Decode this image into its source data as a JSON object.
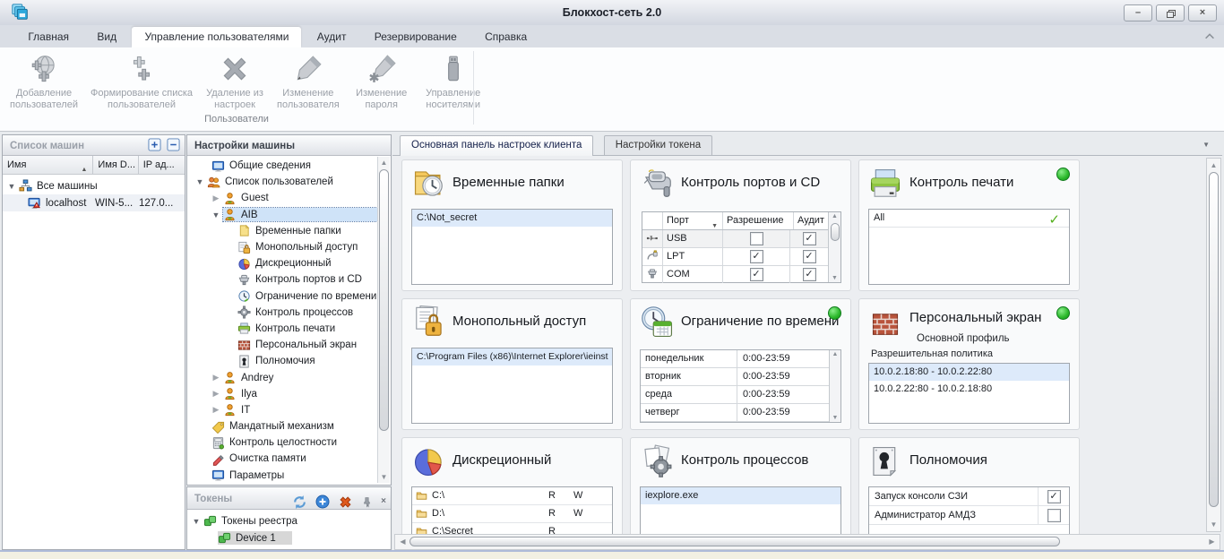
{
  "window": {
    "title": "Блокхост-сеть 2.0",
    "app_icon": "cascade-windows-icon",
    "controls": {
      "minimize": "–",
      "restore": "restore-icon",
      "close": "×"
    }
  },
  "ribbon": {
    "tabs": [
      {
        "label": "Главная"
      },
      {
        "label": "Вид"
      },
      {
        "label": "Управление пользователями",
        "active": true
      },
      {
        "label": "Аудит"
      },
      {
        "label": "Резервирование"
      },
      {
        "label": "Справка"
      }
    ],
    "buttons": [
      {
        "line1": "Добавление",
        "line2": "пользователей",
        "icon": "globe-add-icon"
      },
      {
        "line1": "Формирование списка",
        "line2": "пользователей",
        "icon": "list-add-icon"
      },
      {
        "line1": "Удаление из",
        "line2": "настроек",
        "icon": "delete-x-icon"
      },
      {
        "line1": "Изменение",
        "line2": "пользователя",
        "icon": "pencil-icon"
      },
      {
        "line1": "Изменение",
        "line2": "пароля",
        "icon": "pencil-password-icon"
      },
      {
        "line1": "Управление",
        "line2": "носителями",
        "icon": "usb-drive-icon"
      }
    ],
    "group_label": "Пользователи",
    "collapse_icon": "chevron-up-icon"
  },
  "machines_panel": {
    "title": "Список машин",
    "buttons": {
      "expand": "plus-box-icon",
      "collapse": "minus-box-icon"
    },
    "columns": [
      {
        "label": "Имя",
        "sort": "asc"
      },
      {
        "label": "Имя D..."
      },
      {
        "label": "IP ад..."
      }
    ],
    "root": {
      "label": "Все машины",
      "icon": "network-icon"
    },
    "machine": {
      "name": "localhost",
      "domain": "WIN-5...",
      "ip": "127.0...",
      "icon": "pc-warning-icon"
    }
  },
  "settings_panel": {
    "title": "Настройки машины",
    "items": [
      {
        "label": "Общие сведения",
        "icon": "monitor-icon"
      },
      {
        "label": "Список пользователей",
        "icon": "users-icon",
        "expanded": true
      },
      {
        "label": "Guest",
        "icon": "user-icon",
        "collapsed": true
      },
      {
        "label": "AIB",
        "icon": "user-icon",
        "expanded": true,
        "selected": true
      },
      {
        "label": "Временные папки",
        "icon": "note-icon"
      },
      {
        "label": "Монопольный доступ",
        "icon": "doc-lock-icon"
      },
      {
        "label": "Дискреционный",
        "icon": "pie-icon"
      },
      {
        "label": "Контроль портов и CD",
        "icon": "port-icon"
      },
      {
        "label": "Ограничение по времени",
        "icon": "clock-icon"
      },
      {
        "label": "Контроль процессов",
        "icon": "gear-icon"
      },
      {
        "label": "Контроль печати",
        "icon": "printer-icon"
      },
      {
        "label": "Персональный экран",
        "icon": "bricks-icon"
      },
      {
        "label": "Полномочия",
        "icon": "keyhole-icon"
      },
      {
        "label": "Andrey",
        "icon": "user-icon",
        "collapsed": true
      },
      {
        "label": "Ilya",
        "icon": "user-icon",
        "collapsed": true
      },
      {
        "label": "IT",
        "icon": "user-icon",
        "collapsed": true
      },
      {
        "label": "Мандатный механизм",
        "icon": "tag-icon"
      },
      {
        "label": "Контроль целостности",
        "icon": "calculator-icon"
      },
      {
        "label": "Очистка памяти",
        "icon": "eraser-icon"
      },
      {
        "label": "Параметры",
        "icon": "monitor-icon"
      }
    ]
  },
  "tokens_panel": {
    "title": "Токены",
    "toolbar": [
      {
        "icon": "refresh-icon"
      },
      {
        "icon": "add-circle-icon"
      },
      {
        "icon": "delete-cross-icon"
      },
      {
        "icon": "pin-icon"
      },
      {
        "icon": "close-icon"
      }
    ],
    "root": {
      "label": "Токены реестра",
      "icon": "token-icon"
    },
    "device": {
      "label": "Device 1",
      "icon": "token-icon",
      "selected": true
    }
  },
  "main": {
    "tabs": [
      {
        "label": "Основная панель настроек клиента",
        "active": true
      },
      {
        "label": "Настройки токена"
      }
    ],
    "cards": {
      "temp_folders": {
        "title": "Временные папки",
        "icon": "folder-clock-icon",
        "items": [
          "C:\\Not_secret"
        ]
      },
      "ports": {
        "title": "Контроль портов и CD",
        "icon": "connector-icon",
        "columns": [
          "Порт",
          "Разрешение",
          "Аудит"
        ],
        "rows": [
          {
            "icon": "usb-plug-icon",
            "port": "USB",
            "allow": false,
            "audit": true
          },
          {
            "icon": "lpt-plug-icon",
            "port": "LPT",
            "allow": true,
            "audit": true
          },
          {
            "icon": "com-plug-icon",
            "port": "COM",
            "allow": true,
            "audit": true
          }
        ]
      },
      "print_control": {
        "title": "Контроль печати",
        "icon": "printer-icon",
        "status_green": true,
        "items": [
          "All"
        ]
      },
      "exclusive_access": {
        "title": "Монопольный доступ",
        "icon": "doc-lock-icon",
        "items": [
          "C:\\Program Files (x86)\\Internet Explorer\\ieinst"
        ]
      },
      "time_limit": {
        "title": "Ограничение по времени",
        "icon": "clock-calendar-icon",
        "status_green": true,
        "rows": [
          {
            "day": "понедельник",
            "time": "0:00-23:59"
          },
          {
            "day": "вторник",
            "time": "0:00-23:59"
          },
          {
            "day": "среда",
            "time": "0:00-23:59"
          },
          {
            "day": "четверг",
            "time": "0:00-23:59"
          }
        ]
      },
      "personal_firewall": {
        "title": "Персональный экран",
        "icon": "brick-wall-icon",
        "status_green": true,
        "subtitle": "Основной профиль",
        "policy_label": "Разрешительная политика",
        "items": [
          "10.0.2.18:80 - 10.0.2.22:80",
          "10.0.2.22:80 - 10.0.2.18:80"
        ]
      },
      "discretionary": {
        "title": "Дискреционный",
        "icon": "pie-chart-icon",
        "rows": [
          {
            "path": "C:\\",
            "read": "R",
            "write": "W"
          },
          {
            "path": "D:\\",
            "read": "R",
            "write": "W"
          },
          {
            "path": "C:\\Secret",
            "read": "R",
            "write": ""
          }
        ]
      },
      "process_control": {
        "title": "Контроль процессов",
        "icon": "doc-gear-icon",
        "items": [
          "iexplore.exe"
        ]
      },
      "privileges": {
        "title": "Полномочия",
        "icon": "keyhole-doc-icon",
        "rows": [
          {
            "label": "Запуск консоли СЗИ",
            "checked": true
          },
          {
            "label": "Администратор АМДЗ",
            "checked": false
          }
        ]
      }
    }
  },
  "colors": {
    "status_green": "#2bb82b",
    "tree_selection": "#cfe3f8",
    "list_selection": "#ddeafa",
    "delete_orange": "#e05a1e",
    "accent_blue": "#3d87d8"
  }
}
